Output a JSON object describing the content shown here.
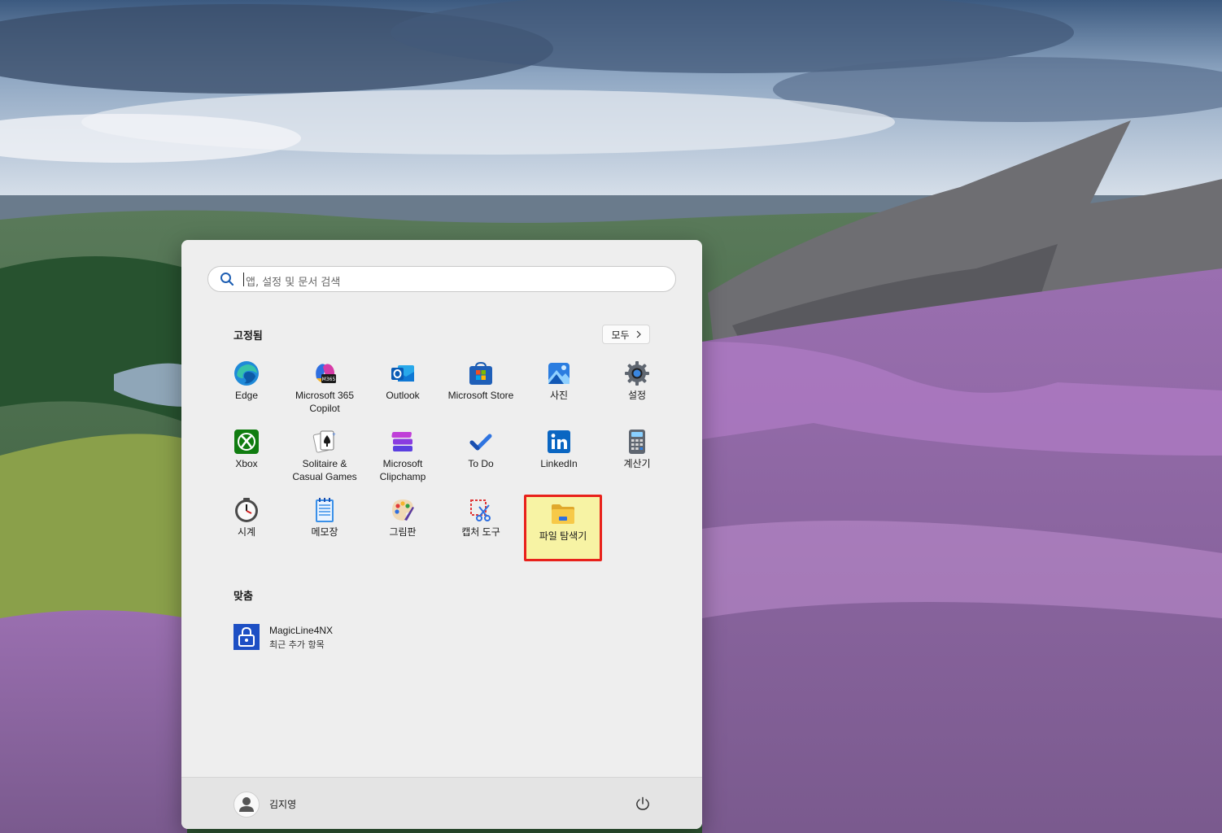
{
  "search": {
    "placeholder": "앱, 설정 및 문서 검색"
  },
  "pinned": {
    "title": "고정됨",
    "all_button": "모두",
    "apps": [
      {
        "label": "Edge",
        "icon": "edge-icon"
      },
      {
        "label": "Microsoft 365\nCopilot",
        "icon": "m365-copilot-icon"
      },
      {
        "label": "Outlook",
        "icon": "outlook-icon"
      },
      {
        "label": "Microsoft Store",
        "icon": "store-icon"
      },
      {
        "label": "사진",
        "icon": "photos-icon"
      },
      {
        "label": "설정",
        "icon": "gear-icon"
      },
      {
        "label": "Xbox",
        "icon": "xbox-icon"
      },
      {
        "label": "Solitaire &\nCasual Games",
        "icon": "solitaire-icon"
      },
      {
        "label": "Microsoft\nClipchamp",
        "icon": "clipchamp-icon"
      },
      {
        "label": "To Do",
        "icon": "todo-check-icon"
      },
      {
        "label": "LinkedIn",
        "icon": "linkedin-icon"
      },
      {
        "label": "계산기",
        "icon": "calculator-icon"
      },
      {
        "label": "시계",
        "icon": "clock-icon"
      },
      {
        "label": "메모장",
        "icon": "notepad-icon"
      },
      {
        "label": "그림판",
        "icon": "paint-palette-icon"
      },
      {
        "label": "캡처 도구",
        "icon": "snipping-tool-icon"
      },
      {
        "label": "파일 탐색기",
        "icon": "folder-icon",
        "selected": true
      }
    ]
  },
  "recommended": {
    "title": "맞춤",
    "items": [
      {
        "name": "MagicLine4NX",
        "sub": "최근 추가 항목",
        "icon": "lock-app-icon"
      }
    ]
  },
  "footer": {
    "user_name": "김지영"
  }
}
